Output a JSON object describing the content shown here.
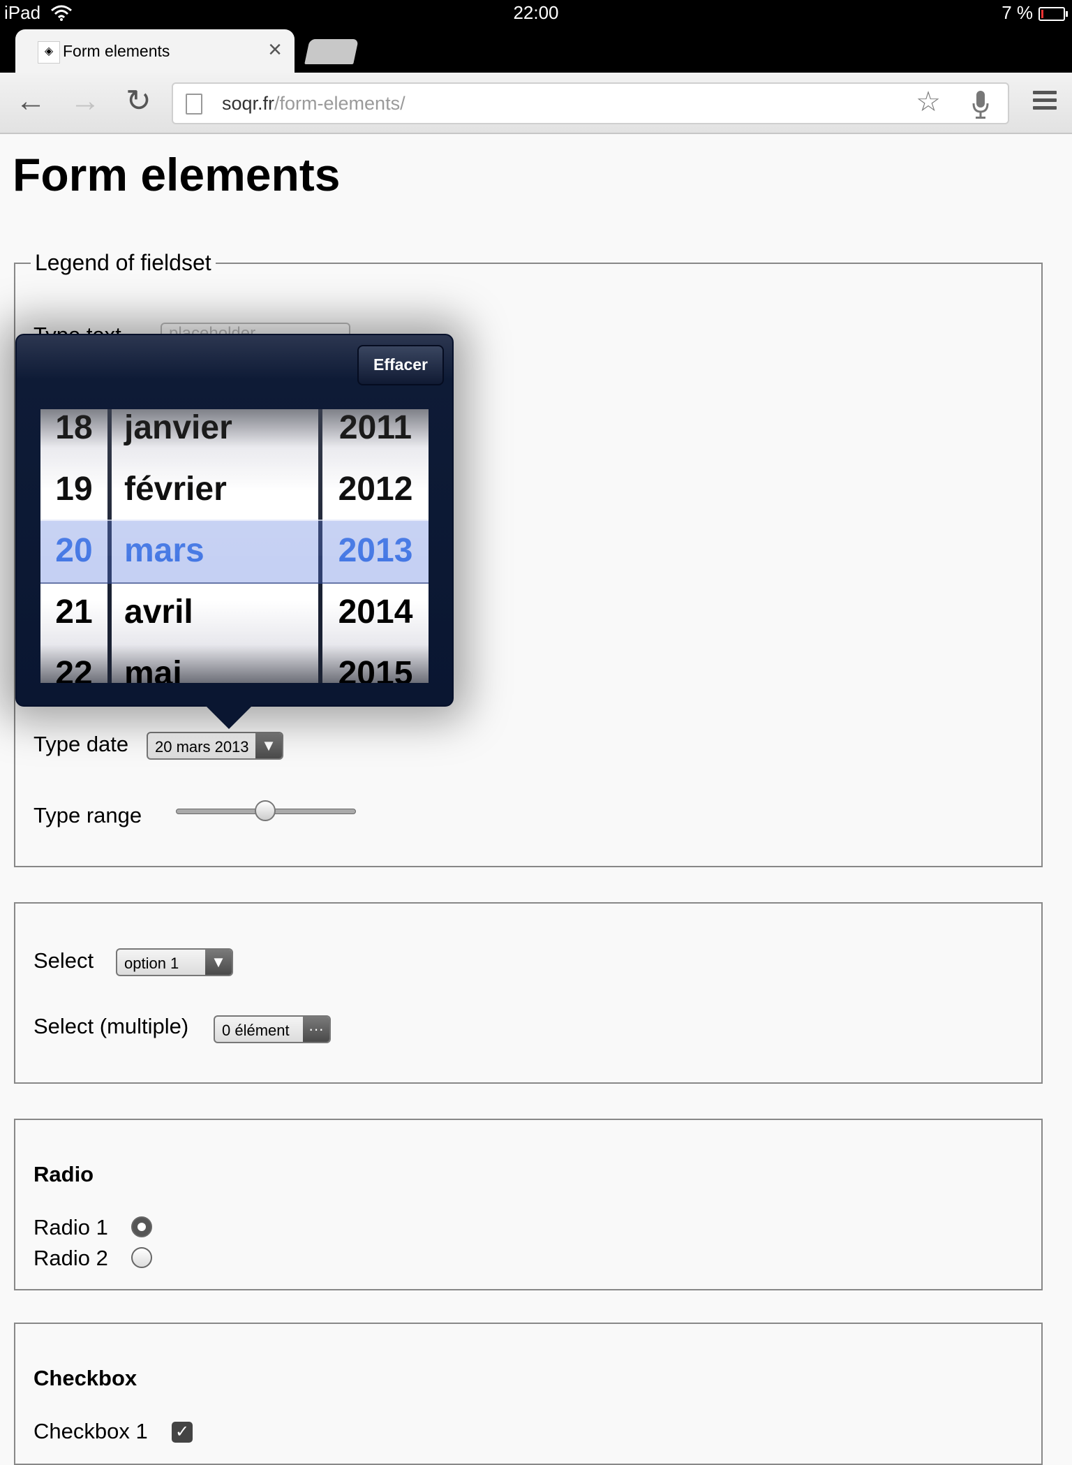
{
  "status_bar": {
    "carrier": "iPad",
    "time": "22:00",
    "battery": "7 %"
  },
  "browser": {
    "tab_title": "Form elements",
    "url_host": "soqr.fr",
    "url_path": "/form-elements/"
  },
  "page": {
    "title": "Form elements",
    "fieldset1": {
      "legend": "Legend of fieldset",
      "text_label": "Type text",
      "text_placeholder": "placeholder",
      "date_label": "Type date",
      "date_value": "20 mars 2013",
      "range_label": "Type range",
      "range_value_fraction": 0.5
    },
    "fieldset2": {
      "select_label": "Select",
      "select_value": "option 1",
      "multi_label": "Select (multiple)",
      "multi_value": "0 élément"
    },
    "fieldset3": {
      "heading": "Radio",
      "radios": [
        {
          "label": "Radio 1",
          "checked": true
        },
        {
          "label": "Radio 2",
          "checked": false
        }
      ]
    },
    "fieldset4": {
      "heading": "Checkbox",
      "checkbox1_label": "Checkbox 1"
    }
  },
  "date_picker": {
    "clear_label": "Effacer",
    "days": [
      "18",
      "19",
      "20",
      "21",
      "22"
    ],
    "months": [
      "janvier",
      "février",
      "mars",
      "avril",
      "mai"
    ],
    "years": [
      "2011",
      "2012",
      "2013",
      "2014",
      "2015"
    ],
    "selected_index": 2,
    "selected_color": "#3b78e8"
  },
  "icons": {
    "back": "←",
    "forward": "→",
    "reload": "↻",
    "close": "×",
    "star": "☆",
    "wifi": "wifi-icon"
  }
}
